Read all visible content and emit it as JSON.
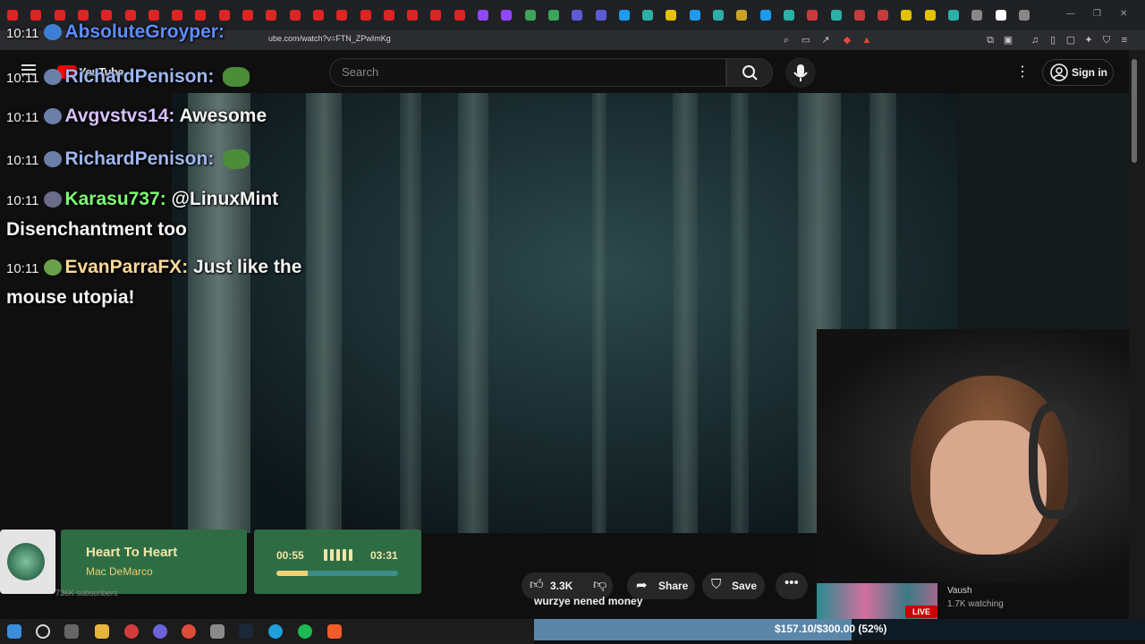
{
  "browser": {
    "url": "ube.com/watch?v=FTN_ZPwImKg"
  },
  "youtube": {
    "search_placeholder": "Search",
    "signin_label": "Sign in",
    "logo_text": "YouTube"
  },
  "chat": [
    {
      "time": "10:11",
      "user": "AbsoluteGroyper",
      "user_color": "#5f8cff",
      "message": ""
    },
    {
      "time": "10:11",
      "user": "RichardPenison",
      "user_color": "#9fb7f0",
      "message": ""
    },
    {
      "time": "10:11",
      "user": "Avgvstvs14",
      "user_color": "#d7c0ff",
      "message": "Awesome"
    },
    {
      "time": "10:11",
      "user": "RichardPenison",
      "user_color": "#9fb7f0",
      "message": ""
    },
    {
      "time": "10:11",
      "user": "Karasu737",
      "user_color": "#7dff73",
      "message": "@LinuxMint",
      "continuation": "Disenchantment too"
    },
    {
      "time": "10:11",
      "user": "EvanParraFX",
      "user_color": "#ffd89a",
      "message": "Just like the",
      "continuation": "mouse utopia!"
    }
  ],
  "now_playing": {
    "title": "Heart To Heart",
    "artist": "Mac DeMarco",
    "current_time": "00:55",
    "total_time": "03:31",
    "progress": 0.26,
    "subscribers": "736K subscribers"
  },
  "actions": {
    "like_count": "3.3K",
    "share_label": "Share",
    "save_label": "Save"
  },
  "subtitle_text": "wurzye nened money",
  "live": {
    "badge": "LIVE",
    "channel": "Vaush",
    "watching": "1.7K watching"
  },
  "donation": {
    "text": "$157.10/$300.00 (52%)",
    "progress": 0.52
  },
  "colors": {
    "accent_green": "#2e6d44",
    "donation_fill": "#5b86a8",
    "live_red": "#cc0000"
  }
}
